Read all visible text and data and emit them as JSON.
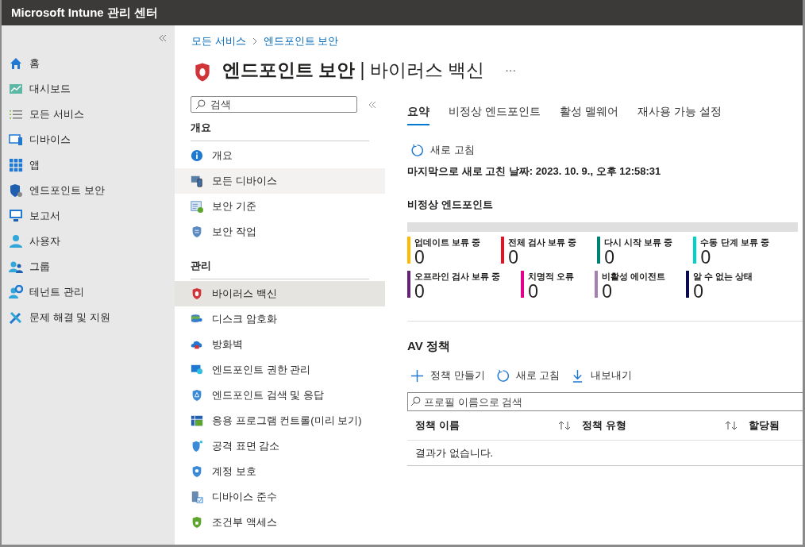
{
  "window": {
    "title": "Microsoft Intune 관리 센터"
  },
  "nav": {
    "items": [
      {
        "label": "홈"
      },
      {
        "label": "대시보드"
      },
      {
        "label": "모든 서비스"
      },
      {
        "label": "디바이스"
      },
      {
        "label": "앱"
      },
      {
        "label": "엔드포인트 보안"
      },
      {
        "label": "보고서"
      },
      {
        "label": "사용자"
      },
      {
        "label": "그룹"
      },
      {
        "label": "테넌트 관리"
      },
      {
        "label": "문제 해결 및 지원"
      }
    ]
  },
  "breadcrumb": [
    "모든 서비스",
    "엔드포인트 보안"
  ],
  "page_title": {
    "main": "엔드포인트 보안",
    "sub": "| 바이러스 백신",
    "more": "···"
  },
  "menu": {
    "search": {
      "placeholder": "검색"
    },
    "sections": [
      {
        "title": "개요",
        "items": [
          {
            "label": "개요",
            "selected": false,
            "hovered": false
          },
          {
            "label": "모든 디바이스",
            "selected": false,
            "hovered": true
          },
          {
            "label": "보안 기준",
            "selected": false,
            "hovered": false
          },
          {
            "label": "보안 작업",
            "selected": false,
            "hovered": false
          }
        ]
      },
      {
        "title": "관리",
        "items": [
          {
            "label": "바이러스 백신",
            "selected": true,
            "hovered": false
          },
          {
            "label": "디스크 암호화",
            "selected": false,
            "hovered": false
          },
          {
            "label": "방화벽",
            "selected": false,
            "hovered": false
          },
          {
            "label": "엔드포인트 권한 관리",
            "selected": false,
            "hovered": false
          },
          {
            "label": "엔드포인트 검색 및 응답",
            "selected": false,
            "hovered": false
          },
          {
            "label": "응용 프로그램 컨트롤(미리 보기)",
            "selected": false,
            "hovered": false
          },
          {
            "label": "공격 표면 감소",
            "selected": false,
            "hovered": false
          },
          {
            "label": "계정 보호",
            "selected": false,
            "hovered": false
          },
          {
            "label": "디바이스 준수",
            "selected": false,
            "hovered": false
          },
          {
            "label": "조건부 액세스",
            "selected": false,
            "hovered": false
          }
        ]
      }
    ]
  },
  "tabs": [
    {
      "label": "요약",
      "selected": true
    },
    {
      "label": "비정상 엔드포인트",
      "selected": false
    },
    {
      "label": "활성 맬웨어",
      "selected": false
    },
    {
      "label": "재사용 가능 설정",
      "selected": false
    }
  ],
  "summary": {
    "refresh": "새로 고침",
    "last_refreshed": "마지막으로 새로 고친 날짜: 2023. 10. 9., 오후 12:58:31",
    "heading": "비정상 엔드포인트",
    "tile_rows": [
      [
        {
          "label": "업데이트 보류 중",
          "value": "0",
          "color": "#ffb900"
        },
        {
          "label": "전체 검사 보류 중",
          "value": "0",
          "color": "#e81123"
        },
        {
          "label": "다시 시작 보류 중",
          "value": "0",
          "color": "#008272"
        },
        {
          "label": "수동 단계 보류 중",
          "value": "0",
          "color": "#00d4c8"
        }
      ],
      [
        {
          "label": "오프라인 검사 보류 중",
          "value": "0",
          "color": "#68217a"
        },
        {
          "label": "치명적 오류",
          "value": "0",
          "color": "#e3008c"
        },
        {
          "label": "비활성 에이전트",
          "value": "0",
          "color": "#a57fb0"
        },
        {
          "label": "알 수 없는 상태",
          "value": "0",
          "color": "#0b0b4f"
        }
      ]
    ]
  },
  "policies": {
    "heading": "AV 정책",
    "toolbar": [
      {
        "label": "정책 만들기"
      },
      {
        "label": "새로 고침"
      },
      {
        "label": "내보내기"
      }
    ],
    "search": {
      "placeholder": "프로필 이름으로 검색"
    },
    "columns": [
      {
        "label": "정책 이름",
        "sortable": true
      },
      {
        "label": "정책 유형",
        "sortable": true
      },
      {
        "label": "할당됨",
        "sortable": false
      }
    ],
    "empty": "결과가 없습니다."
  }
}
